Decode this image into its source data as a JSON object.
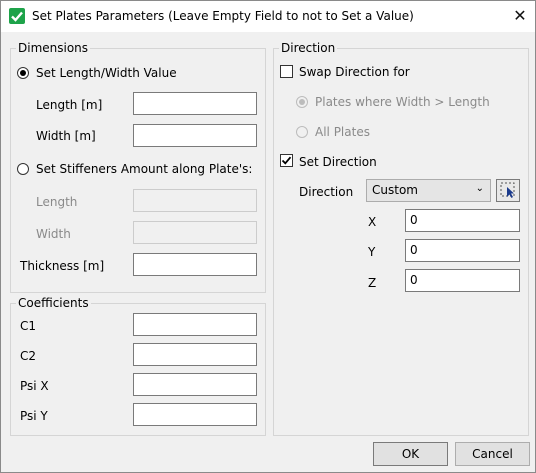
{
  "window": {
    "title": "Set Plates Parameters (Leave Empty Field to not to Set a Value)",
    "accent": "#1ea34a"
  },
  "dimensions": {
    "legend": "Dimensions",
    "set_length_width_label": "Set Length/Width Value",
    "length_label": "Length [m]",
    "length_value": "",
    "width_label": "Width [m]",
    "width_value": "",
    "stiffeners_label": "Set Stiffeners Amount along Plate's:",
    "stiff_length_label": "Length",
    "stiff_width_label": "Width",
    "thickness_label": "Thickness [m]",
    "thickness_value": ""
  },
  "coefficients": {
    "legend": "Coefficients",
    "c1_label": "C1",
    "c1_value": "",
    "c2_label": "C2",
    "c2_value": "",
    "psix_label": "Psi X",
    "psix_value": "",
    "psiy_label": "Psi Y",
    "psiy_value": ""
  },
  "direction": {
    "legend": "Direction",
    "swap_label": "Swap Direction for",
    "swap_opt1": "Plates where Width > Length",
    "swap_opt2": "All Plates",
    "set_direction_label": "Set Direction",
    "direction_label": "Direction",
    "direction_value": "Custom",
    "x_label": "X",
    "x_value": "0",
    "y_label": "Y",
    "y_value": "0",
    "z_label": "Z",
    "z_value": "0"
  },
  "buttons": {
    "ok": "OK",
    "cancel": "Cancel"
  }
}
